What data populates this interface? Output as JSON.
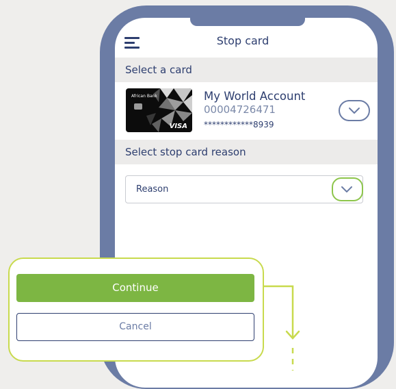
{
  "header": {
    "title": "Stop card",
    "menu_icon": "hamburger-menu-icon"
  },
  "select_card": {
    "section_label": "Select a card",
    "card": {
      "bank_name": "African Bank",
      "network": "VISA",
      "account_name": "My World Account",
      "account_number": "00004726471",
      "masked_card_number": "************8939"
    },
    "dropdown_icon": "chevron-down-icon"
  },
  "stop_reason": {
    "section_label": "Select stop card reason",
    "select_value": "Reason",
    "dropdown_icon": "chevron-down-icon"
  },
  "actions": {
    "continue_label": "Continue",
    "cancel_label": "Cancel"
  },
  "colors": {
    "primary_navy": "#2d3e6f",
    "accent_green": "#7db643",
    "highlight_lime": "#c8da4d",
    "phone_frame": "#6b7ca5"
  }
}
